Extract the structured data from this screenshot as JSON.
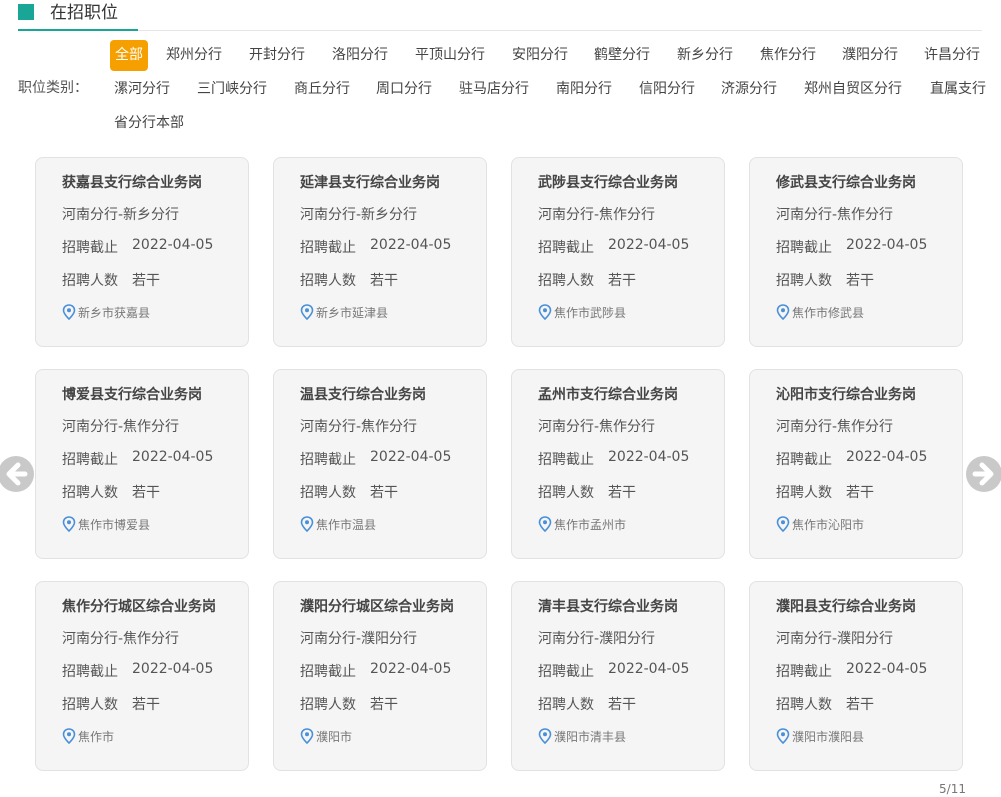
{
  "header": {
    "title": "在招职位"
  },
  "filter": {
    "label": "职位类别：",
    "items": [
      "全部",
      "郑州分行",
      "开封分行",
      "洛阳分行",
      "平顶山分行",
      "安阳分行",
      "鹤壁分行",
      "新乡分行",
      "焦作分行",
      "濮阳分行",
      "许昌分行",
      "漯河分行",
      "三门峡分行",
      "商丘分行",
      "周口分行",
      "驻马店分行",
      "南阳分行",
      "信阳分行",
      "济源分行",
      "郑州自贸区分行",
      "直属支行",
      "省分行本部"
    ],
    "active_index": 0
  },
  "card_labels": {
    "deadline": "招聘截止",
    "count": "招聘人数"
  },
  "cards": [
    {
      "title": "获嘉县支行综合业务岗",
      "branch": "河南分行-新乡分行",
      "deadline": "2022-04-05",
      "count": "若干",
      "location": "新乡市获嘉县"
    },
    {
      "title": "延津县支行综合业务岗",
      "branch": "河南分行-新乡分行",
      "deadline": "2022-04-05",
      "count": "若干",
      "location": "新乡市延津县"
    },
    {
      "title": "武陟县支行综合业务岗",
      "branch": "河南分行-焦作分行",
      "deadline": "2022-04-05",
      "count": "若干",
      "location": "焦作市武陟县"
    },
    {
      "title": "修武县支行综合业务岗",
      "branch": "河南分行-焦作分行",
      "deadline": "2022-04-05",
      "count": "若干",
      "location": "焦作市修武县"
    },
    {
      "title": "博爱县支行综合业务岗",
      "branch": "河南分行-焦作分行",
      "deadline": "2022-04-05",
      "count": "若干",
      "location": "焦作市博爱县"
    },
    {
      "title": "温县支行综合业务岗",
      "branch": "河南分行-焦作分行",
      "deadline": "2022-04-05",
      "count": "若干",
      "location": "焦作市温县"
    },
    {
      "title": "孟州市支行综合业务岗",
      "branch": "河南分行-焦作分行",
      "deadline": "2022-04-05",
      "count": "若干",
      "location": "焦作市孟州市"
    },
    {
      "title": "沁阳市支行综合业务岗",
      "branch": "河南分行-焦作分行",
      "deadline": "2022-04-05",
      "count": "若干",
      "location": "焦作市沁阳市"
    },
    {
      "title": "焦作分行城区综合业务岗",
      "branch": "河南分行-焦作分行",
      "deadline": "2022-04-05",
      "count": "若干",
      "location": "焦作市"
    },
    {
      "title": "濮阳分行城区综合业务岗",
      "branch": "河南分行-濮阳分行",
      "deadline": "2022-04-05",
      "count": "若干",
      "location": "濮阳市"
    },
    {
      "title": "清丰县支行综合业务岗",
      "branch": "河南分行-濮阳分行",
      "deadline": "2022-04-05",
      "count": "若干",
      "location": "濮阳市清丰县"
    },
    {
      "title": "濮阳县支行综合业务岗",
      "branch": "河南分行-濮阳分行",
      "deadline": "2022-04-05",
      "count": "若干",
      "location": "濮阳市濮阳县"
    }
  ],
  "pager": {
    "text": "5/11"
  },
  "icons": {
    "prev": "arrow-left-icon",
    "next": "arrow-right-icon",
    "location": "location-pin-icon"
  },
  "colors": {
    "accent": "#1aa697",
    "active_filter": "#f5a000",
    "pin": "#4a90d9"
  }
}
